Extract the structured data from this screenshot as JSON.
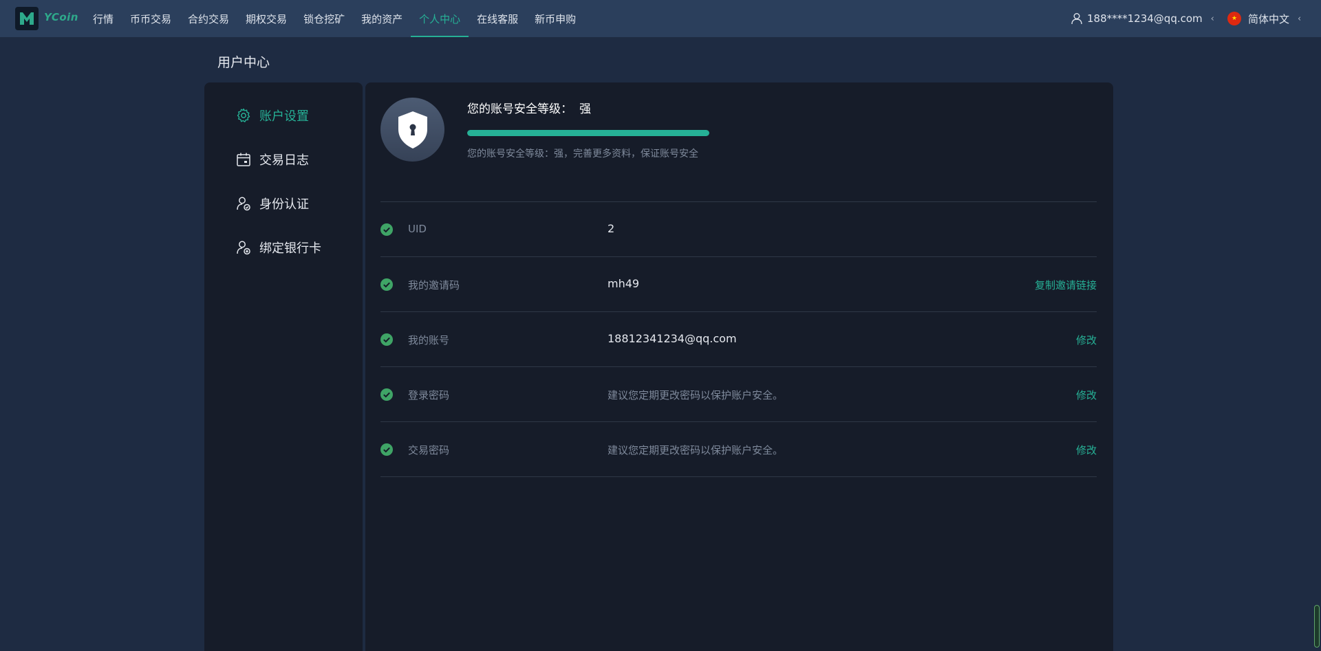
{
  "app": {
    "logo_text": "YCoin"
  },
  "nav": {
    "items": [
      {
        "label": "行情"
      },
      {
        "label": "币币交易"
      },
      {
        "label": "合约交易"
      },
      {
        "label": "期权交易"
      },
      {
        "label": "锁仓挖矿"
      },
      {
        "label": "我的资产"
      },
      {
        "label": "个人中心"
      },
      {
        "label": "在线客服"
      },
      {
        "label": "新币申购"
      }
    ],
    "active_index": 6,
    "user_email": "188****1234@qq.com",
    "chevron": "‹",
    "language": "简体中文",
    "flag_icon": "china-flag-icon"
  },
  "page": {
    "title": "用户中心"
  },
  "sidebar": {
    "items": [
      {
        "label": "账户设置",
        "icon": "gear-icon"
      },
      {
        "label": "交易日志",
        "icon": "calendar-icon"
      },
      {
        "label": "身份认证",
        "icon": "user-verify-icon"
      },
      {
        "label": "绑定银行卡",
        "icon": "user-card-icon"
      }
    ],
    "active_index": 0
  },
  "security": {
    "title": "您的账号安全等级：",
    "level": "强",
    "progress_percent": 100,
    "description": "您的账号安全等级：强，完善更多资料，保证账号安全",
    "accent_color": "#26b196"
  },
  "rows": [
    {
      "label": "UID",
      "value": "2",
      "action": ""
    },
    {
      "label": "我的邀请码",
      "value": "mh49",
      "action": "复制邀请链接"
    },
    {
      "label": "我的账号",
      "value": "18812341234@qq.com",
      "action": "修改"
    },
    {
      "label": "登录密码",
      "value": "建议您定期更改密码以保护账户安全。",
      "action": "修改"
    },
    {
      "label": "交易密码",
      "value": "建议您定期更改密码以保护账户安全。",
      "action": "修改"
    }
  ]
}
